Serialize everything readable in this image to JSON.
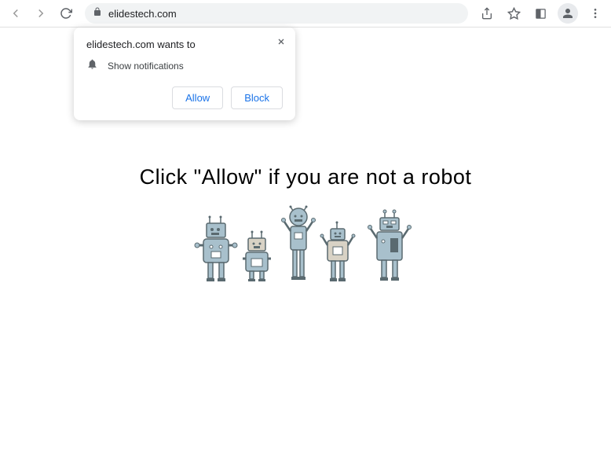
{
  "address_bar": {
    "url": "elidestech.com"
  },
  "popup": {
    "title": "elidestech.com wants to",
    "permission": "Show notifications",
    "allow_label": "Allow",
    "block_label": "Block"
  },
  "page": {
    "main_text": "Click \"Allow\"   if you are not   a robot"
  }
}
